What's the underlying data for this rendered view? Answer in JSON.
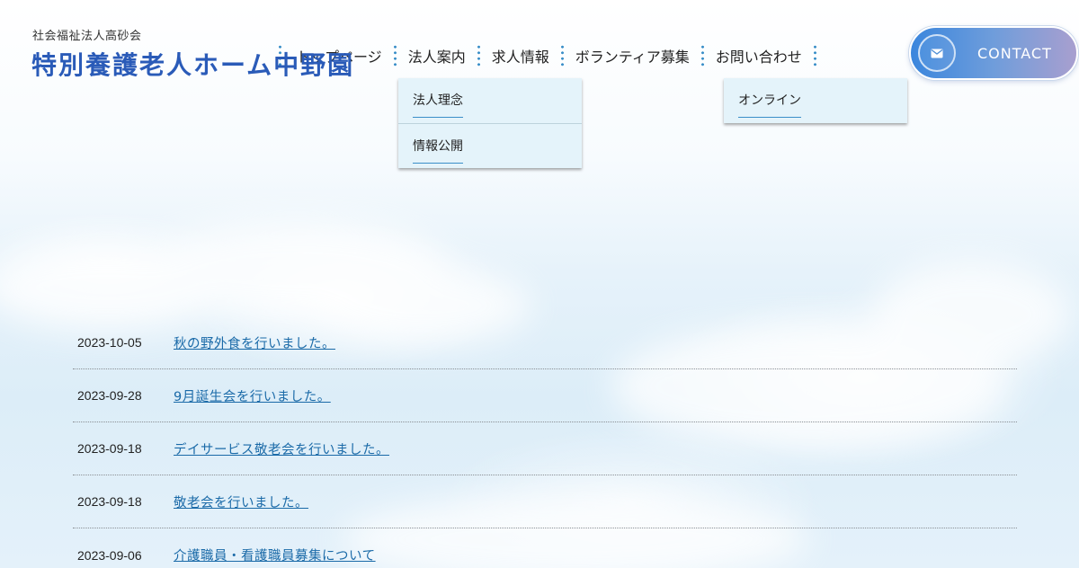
{
  "header": {
    "subtitle": "社会福祉法人高砂会",
    "title": "特別養護老人ホーム中野園"
  },
  "nav": {
    "items": [
      {
        "label": "トップページ"
      },
      {
        "label": "法人案内"
      },
      {
        "label": "求人情報"
      },
      {
        "label": "ボランティア募集"
      },
      {
        "label": "お問い合わせ"
      }
    ]
  },
  "dropdowns": {
    "houjin": [
      {
        "label": "法人理念"
      },
      {
        "label": "情報公開"
      }
    ],
    "contact": [
      {
        "label": "オンライン"
      }
    ]
  },
  "contact_button": {
    "label": "CONTACT",
    "icon": "envelope-icon"
  },
  "news": [
    {
      "date": "2023-10-05",
      "title": "秋の野外食を行いました。"
    },
    {
      "date": "2023-09-28",
      "title": "9月誕生会を行いました。"
    },
    {
      "date": "2023-09-18",
      "title": "デイサービス敬老会を行いました。"
    },
    {
      "date": "2023-09-18",
      "title": "敬老会を行いました。"
    },
    {
      "date": "2023-09-06",
      "title": "介護職員・看護職員募集について"
    }
  ],
  "colors": {
    "title": "#2a5bb8",
    "link": "#1a6aa8",
    "nav_dots": "#3a8fc8",
    "dropdown_bg": "#e4f3fa"
  }
}
